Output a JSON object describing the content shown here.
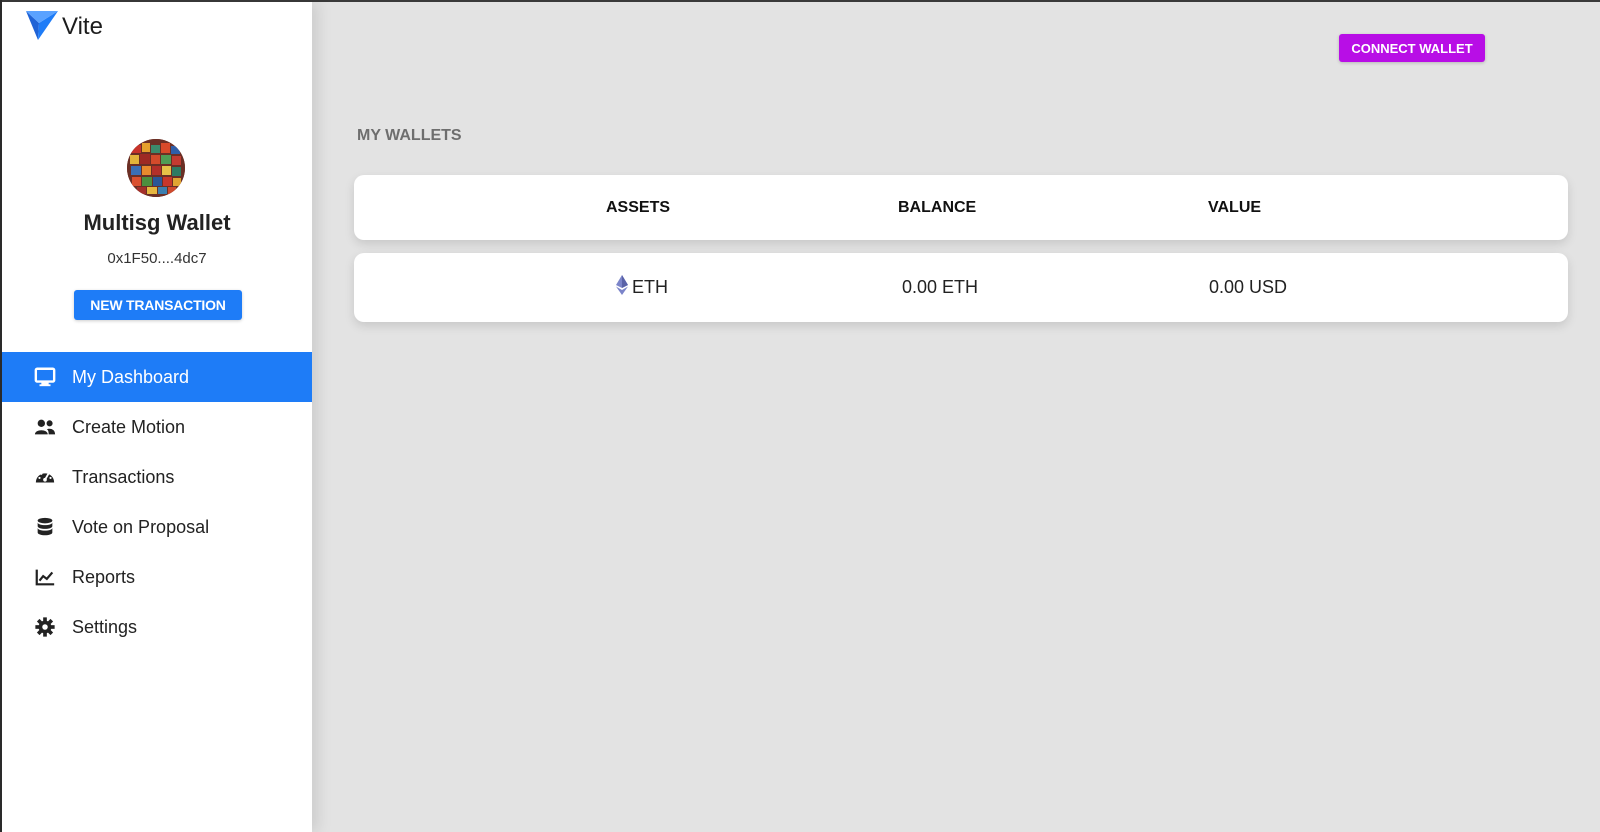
{
  "app": {
    "logo_text": "Vite"
  },
  "profile": {
    "wallet_name": "Multisg Wallet",
    "address": "0x1F50....4dc7",
    "new_transaction_label": "NEW TRANSACTION"
  },
  "nav": {
    "items": [
      {
        "label": "My Dashboard",
        "icon": "monitor-icon",
        "active": true
      },
      {
        "label": "Create Motion",
        "icon": "users-icon",
        "active": false
      },
      {
        "label": "Transactions",
        "icon": "gauge-icon",
        "active": false
      },
      {
        "label": "Vote on Proposal",
        "icon": "database-icon",
        "active": false
      },
      {
        "label": "Reports",
        "icon": "line-chart-icon",
        "active": false
      },
      {
        "label": "Settings",
        "icon": "gear-icon",
        "active": false
      }
    ]
  },
  "header": {
    "connect_wallet_label": "CONNECT WALLET"
  },
  "wallets": {
    "title": "MY WALLETS",
    "columns": [
      "ASSETS",
      "BALANCE",
      "VALUE"
    ],
    "rows": [
      {
        "asset": "ETH",
        "asset_icon": "ethereum-icon",
        "balance": "0.00 ETH",
        "value": "0.00 USD"
      }
    ]
  },
  "colors": {
    "primary": "#1e7cf7",
    "connect_button": "#b80ee6",
    "background": "#e3e3e3",
    "sidebar": "#ffffff"
  }
}
